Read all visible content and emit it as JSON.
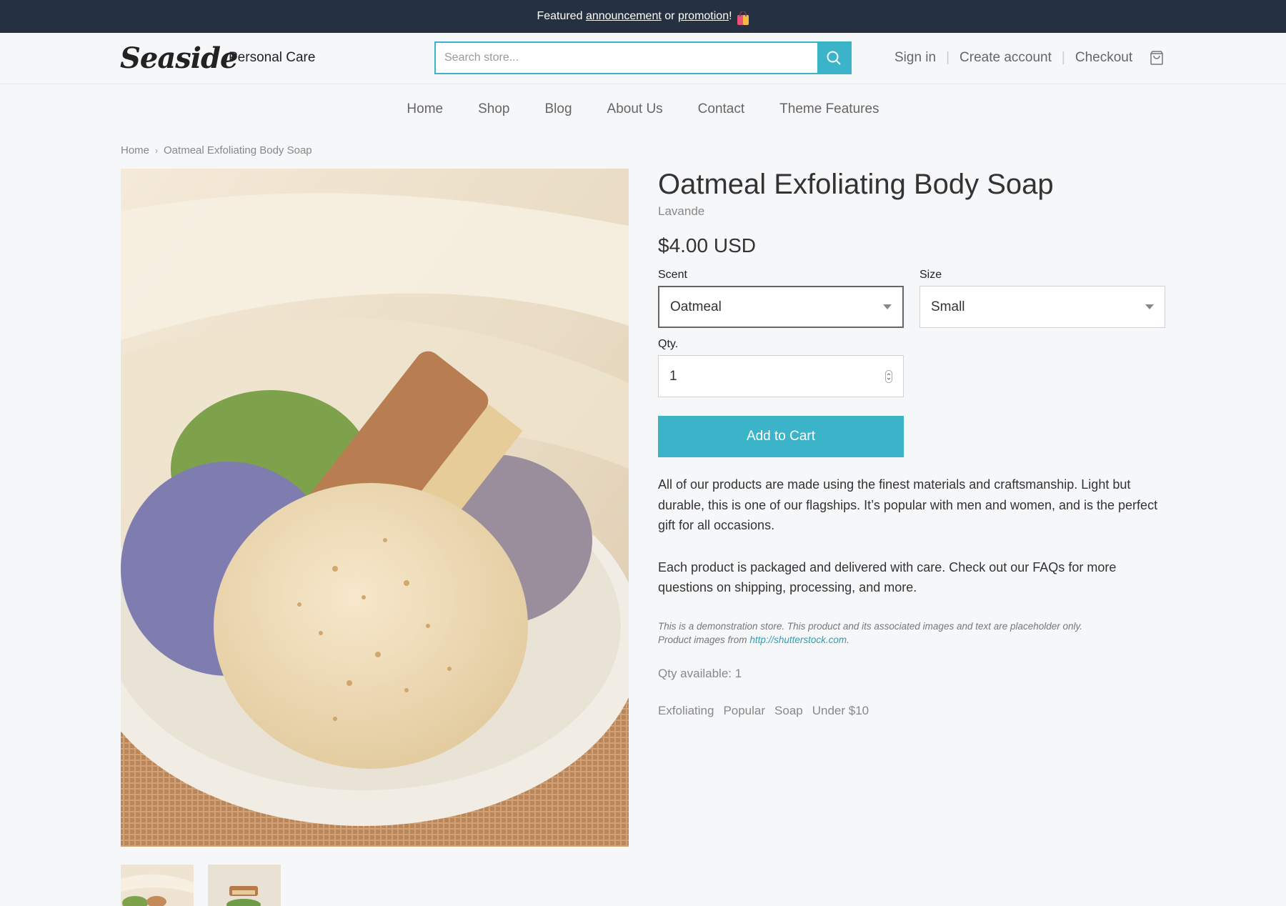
{
  "announcement": {
    "prefix": "Featured",
    "link1": "announcement",
    "middle": "or",
    "link2": "promotion",
    "suffix": "!"
  },
  "header": {
    "logo": "Seaside",
    "shop_name": "Personal Care",
    "search_placeholder": "Search store...",
    "sign_in": "Sign in",
    "create_account": "Create account",
    "checkout": "Checkout",
    "separator": "|"
  },
  "nav": {
    "items": [
      "Home",
      "Shop",
      "Blog",
      "About Us",
      "Contact",
      "Theme Features"
    ]
  },
  "breadcrumb": {
    "home": "Home",
    "separator": "›",
    "current": "Oatmeal Exfoliating Body Soap"
  },
  "product": {
    "title": "Oatmeal Exfoliating Body Soap",
    "vendor": "Lavande",
    "price": "$4.00 USD",
    "scent_label": "Scent",
    "scent_value": "Oatmeal",
    "size_label": "Size",
    "size_value": "Small",
    "qty_label": "Qty.",
    "qty_value": "1",
    "add_to_cart": "Add to Cart",
    "description_1": "All of our products are made using the finest materials and craftsmanship. Light but durable, this is one of our flagships. It’s popular with men and women, and is the perfect gift for all occasions.",
    "description_2": "Each product is packaged and delivered with care. Check out our FAQs for more questions on shipping, processing, and more.",
    "note_line1": "This is a demonstration store. This product and its associated images and text are placeholder only.",
    "note_line2_prefix": "Product images from",
    "note_link": "http://shutterstock.com",
    "note_suffix": ".",
    "qty_available": "Qty available: 1",
    "tags": [
      "Exfoliating",
      "Popular",
      "Soap",
      "Under $10"
    ]
  },
  "colors": {
    "accent": "#3bb3c8",
    "announcement_bg": "#253141",
    "page_bg": "#f6f7f9"
  },
  "icons": {
    "search": "search-icon",
    "cart": "cart-icon",
    "gift": "shopping-bag-emoji",
    "dropdown": "caret-down-icon",
    "stepper": "number-stepper-icon"
  }
}
